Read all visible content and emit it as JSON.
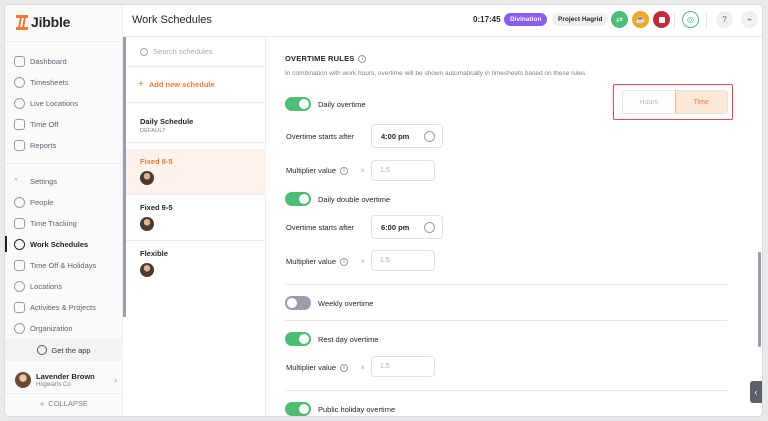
{
  "app": {
    "name": "Jibble"
  },
  "sidebar": {
    "items": [
      {
        "label": "Dashboard"
      },
      {
        "label": "Timesheets"
      },
      {
        "label": "Live Locations"
      },
      {
        "label": "Time Off"
      },
      {
        "label": "Reports"
      },
      {
        "label": "Settings"
      },
      {
        "label": "People"
      },
      {
        "label": "Time Tracking"
      },
      {
        "label": "Work Schedules"
      },
      {
        "label": "Time Off & Holidays"
      },
      {
        "label": "Locations"
      },
      {
        "label": "Activities & Projects"
      },
      {
        "label": "Organization"
      }
    ],
    "get_app": "Get the app",
    "user": {
      "name": "Lavender Brown",
      "org": "Hogwarts Co"
    },
    "collapse": "COLLAPSE"
  },
  "header": {
    "title": "Work Schedules",
    "timer": "0:17:45",
    "activity": "Divination",
    "project": "Project Hagrid",
    "colors": {
      "activity_badge": "#8a5cf6",
      "green_btn": "#4cbe74",
      "orange_btn": "#f5a623",
      "red_btn": "#c5283d",
      "accent": "#f37a30"
    }
  },
  "schedules": {
    "search_placeholder": "Search schedules",
    "add_label": "Add new schedule",
    "list": [
      {
        "name": "Daily Schedule",
        "tag": "DEFAULT"
      },
      {
        "name": "Fixed 8-5"
      },
      {
        "name": "Fixed 9-5"
      },
      {
        "name": "Flexible"
      }
    ]
  },
  "overtime": {
    "title": "OVERTIME RULES",
    "description": "In combination with work hours, overtime will be shown automatically in timesheets based on these rules.",
    "mode": {
      "options": [
        "Hours",
        "Time"
      ],
      "selected": "Time"
    },
    "daily": {
      "label": "Daily overtime",
      "enabled": true,
      "starts_label": "Overtime starts after",
      "starts_value": "4:00 pm",
      "multiplier_label": "Multiplier value",
      "multiplier_value": "1.5"
    },
    "daily_double": {
      "label": "Daily double overtime",
      "enabled": true,
      "starts_label": "Overtime starts after",
      "starts_value": "6:00 pm",
      "multiplier_label": "Multiplier value",
      "multiplier_value": "1.5"
    },
    "weekly": {
      "label": "Weekly overtime",
      "enabled": false
    },
    "rest_day": {
      "label": "Rest day overtime",
      "enabled": true,
      "multiplier_label": "Multiplier value",
      "multiplier_value": "1.5"
    },
    "public_holiday": {
      "label": "Public holiday overtime",
      "enabled": true
    },
    "multiplier_symbol": "x"
  }
}
